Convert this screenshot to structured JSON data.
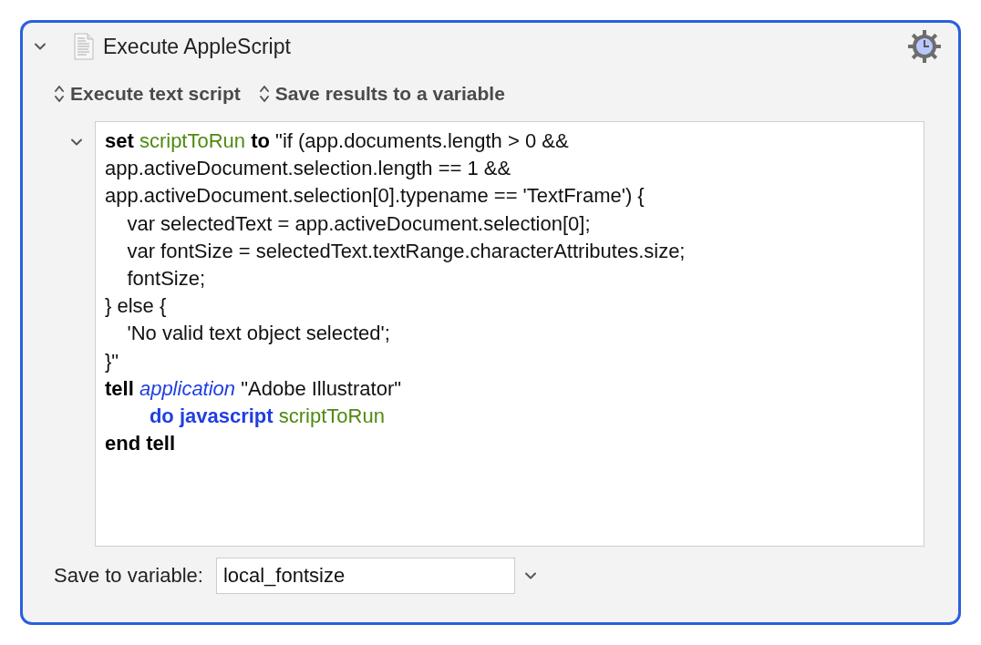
{
  "action": {
    "title": "Execute AppleScript",
    "expanded": true
  },
  "popups": [
    {
      "label": "Execute text script"
    },
    {
      "label": "Save results to a variable"
    }
  ],
  "script": {
    "expanded": true,
    "lines": [
      [
        {
          "kind": "keyword",
          "text": "set "
        },
        {
          "kind": "variable",
          "text": "scriptToRun"
        },
        {
          "kind": "keyword",
          "text": " to"
        },
        {
          "kind": "plain",
          "text": " \"if (app.documents.length > 0 &&"
        }
      ],
      [
        {
          "kind": "plain",
          "text": "app.activeDocument.selection.length == 1 &&"
        }
      ],
      [
        {
          "kind": "plain",
          "text": "app.activeDocument.selection[0].typename == 'TextFrame') {"
        }
      ],
      [
        {
          "kind": "plain",
          "text": "    var selectedText = app.activeDocument.selection[0];"
        }
      ],
      [
        {
          "kind": "plain",
          "text": "    var fontSize = selectedText.textRange.characterAttributes.size;"
        }
      ],
      [
        {
          "kind": "plain",
          "text": "    fontSize;"
        }
      ],
      [
        {
          "kind": "plain",
          "text": "} else {"
        }
      ],
      [
        {
          "kind": "plain",
          "text": "    'No valid text object selected';"
        }
      ],
      [
        {
          "kind": "plain",
          "text": "}\""
        }
      ],
      [
        {
          "kind": "keyword",
          "text": "tell "
        },
        {
          "kind": "class",
          "text": "application"
        },
        {
          "kind": "plain",
          "text": " \"Adobe Illustrator\""
        }
      ],
      [
        {
          "kind": "command",
          "text": "        do javascript "
        },
        {
          "kind": "variable",
          "text": "scriptToRun"
        }
      ],
      [
        {
          "kind": "keyword",
          "text": "end tell"
        }
      ]
    ]
  },
  "save_to_variable": {
    "label": "Save to variable:",
    "value": "local_fontsize"
  }
}
